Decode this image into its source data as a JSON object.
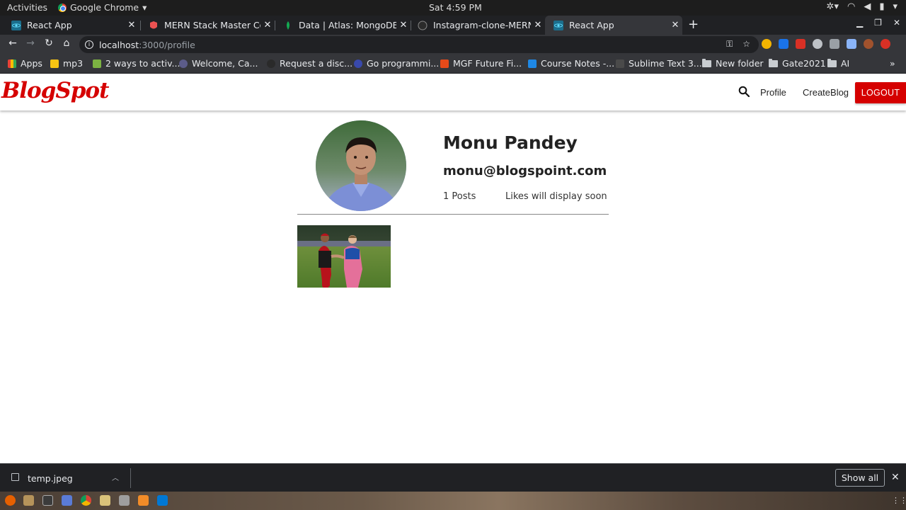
{
  "system_bar": {
    "activities": "Activities",
    "app_name": "Google Chrome",
    "clock": "Sat  4:59 PM"
  },
  "browser": {
    "tabs": [
      {
        "title": "React App",
        "active": false
      },
      {
        "title": "MERN Stack Master Course",
        "active": false
      },
      {
        "title": "Data | Atlas: MongoDB Atlas",
        "active": false
      },
      {
        "title": "Instagram-clone-MERN-Stack",
        "active": false
      },
      {
        "title": "React App",
        "active": true
      }
    ],
    "url_host": "localhost",
    "url_path": ":3000/profile",
    "bookmarks": [
      {
        "label": "Apps",
        "icon": "apps-grid-icon"
      },
      {
        "label": "mp3",
        "icon": "mp3-icon"
      },
      {
        "label": "2 ways to activ...",
        "icon": "bookmark-icon"
      },
      {
        "label": "Welcome, Ca...",
        "icon": "bookmark-icon"
      },
      {
        "label": "Request a disc...",
        "icon": "bookmark-icon"
      },
      {
        "label": "Go programmi...",
        "icon": "bookmark-icon"
      },
      {
        "label": "MGF Future Fi...",
        "icon": "bookmark-icon"
      },
      {
        "label": "Course Notes -...",
        "icon": "bookmark-icon"
      },
      {
        "label": "Sublime Text 3...",
        "icon": "bookmark-icon"
      },
      {
        "label": "New folder",
        "icon": "folder-icon"
      },
      {
        "label": "Gate2021",
        "icon": "folder-icon"
      },
      {
        "label": "AI",
        "icon": "folder-icon"
      }
    ],
    "overflow": "»"
  },
  "app": {
    "logo": "BlogSpot",
    "brand_color": "#d50000",
    "nav": {
      "profile": "Profile",
      "create_blog": "CreateBlog",
      "logout": "LOGOUT"
    }
  },
  "profile": {
    "name": "Monu Pandey",
    "email": "monu@blogspoint.com",
    "posts": "1 Posts",
    "likes": "Likes will display soon"
  },
  "downloads": {
    "file_name": "temp.jpeg",
    "show_all": "Show all"
  }
}
